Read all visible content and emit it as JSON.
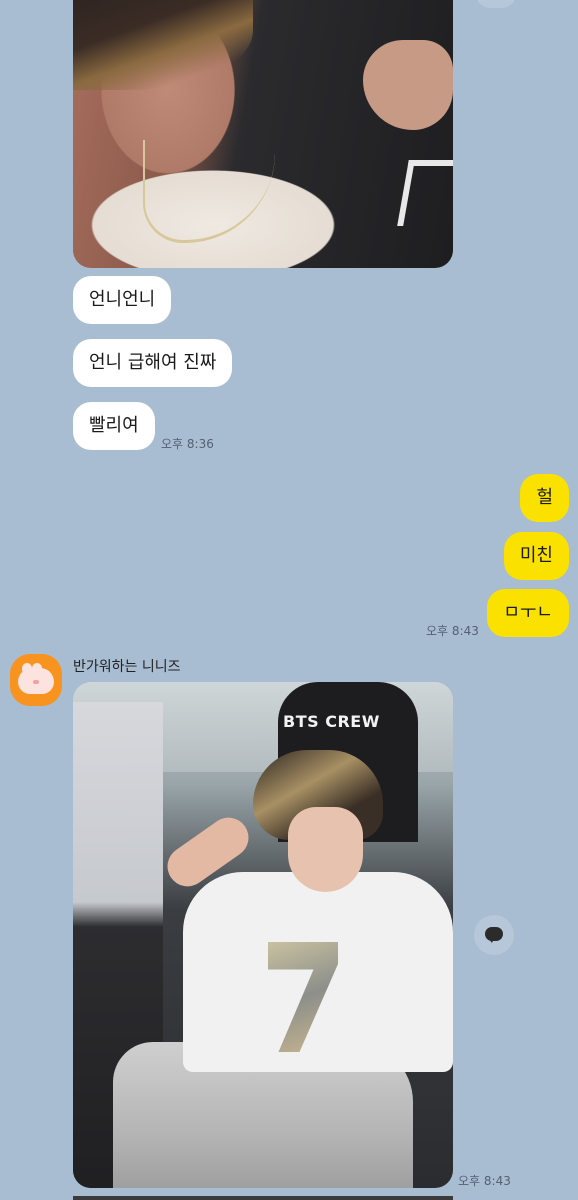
{
  "messages_in": [
    {
      "text": "언니언니"
    },
    {
      "text": "언니 급해여 진짜"
    },
    {
      "text": "빨리여"
    }
  ],
  "time_in": "오후 8:36",
  "messages_out": [
    {
      "text": "헐"
    },
    {
      "text": "미친"
    },
    {
      "text": "ㅁㅜㄴ"
    }
  ],
  "time_out": "오후 8:43",
  "sender": {
    "name": "반가워하는 니니즈",
    "avatar_icon": "ninis-bunny-icon"
  },
  "photo_main": {
    "shirt_text": "BTS CREW"
  },
  "time_photo": "오후 8:43",
  "colors": {
    "background": "#a9bdd2",
    "bubble_in": "#ffffff",
    "bubble_out": "#fae100"
  }
}
